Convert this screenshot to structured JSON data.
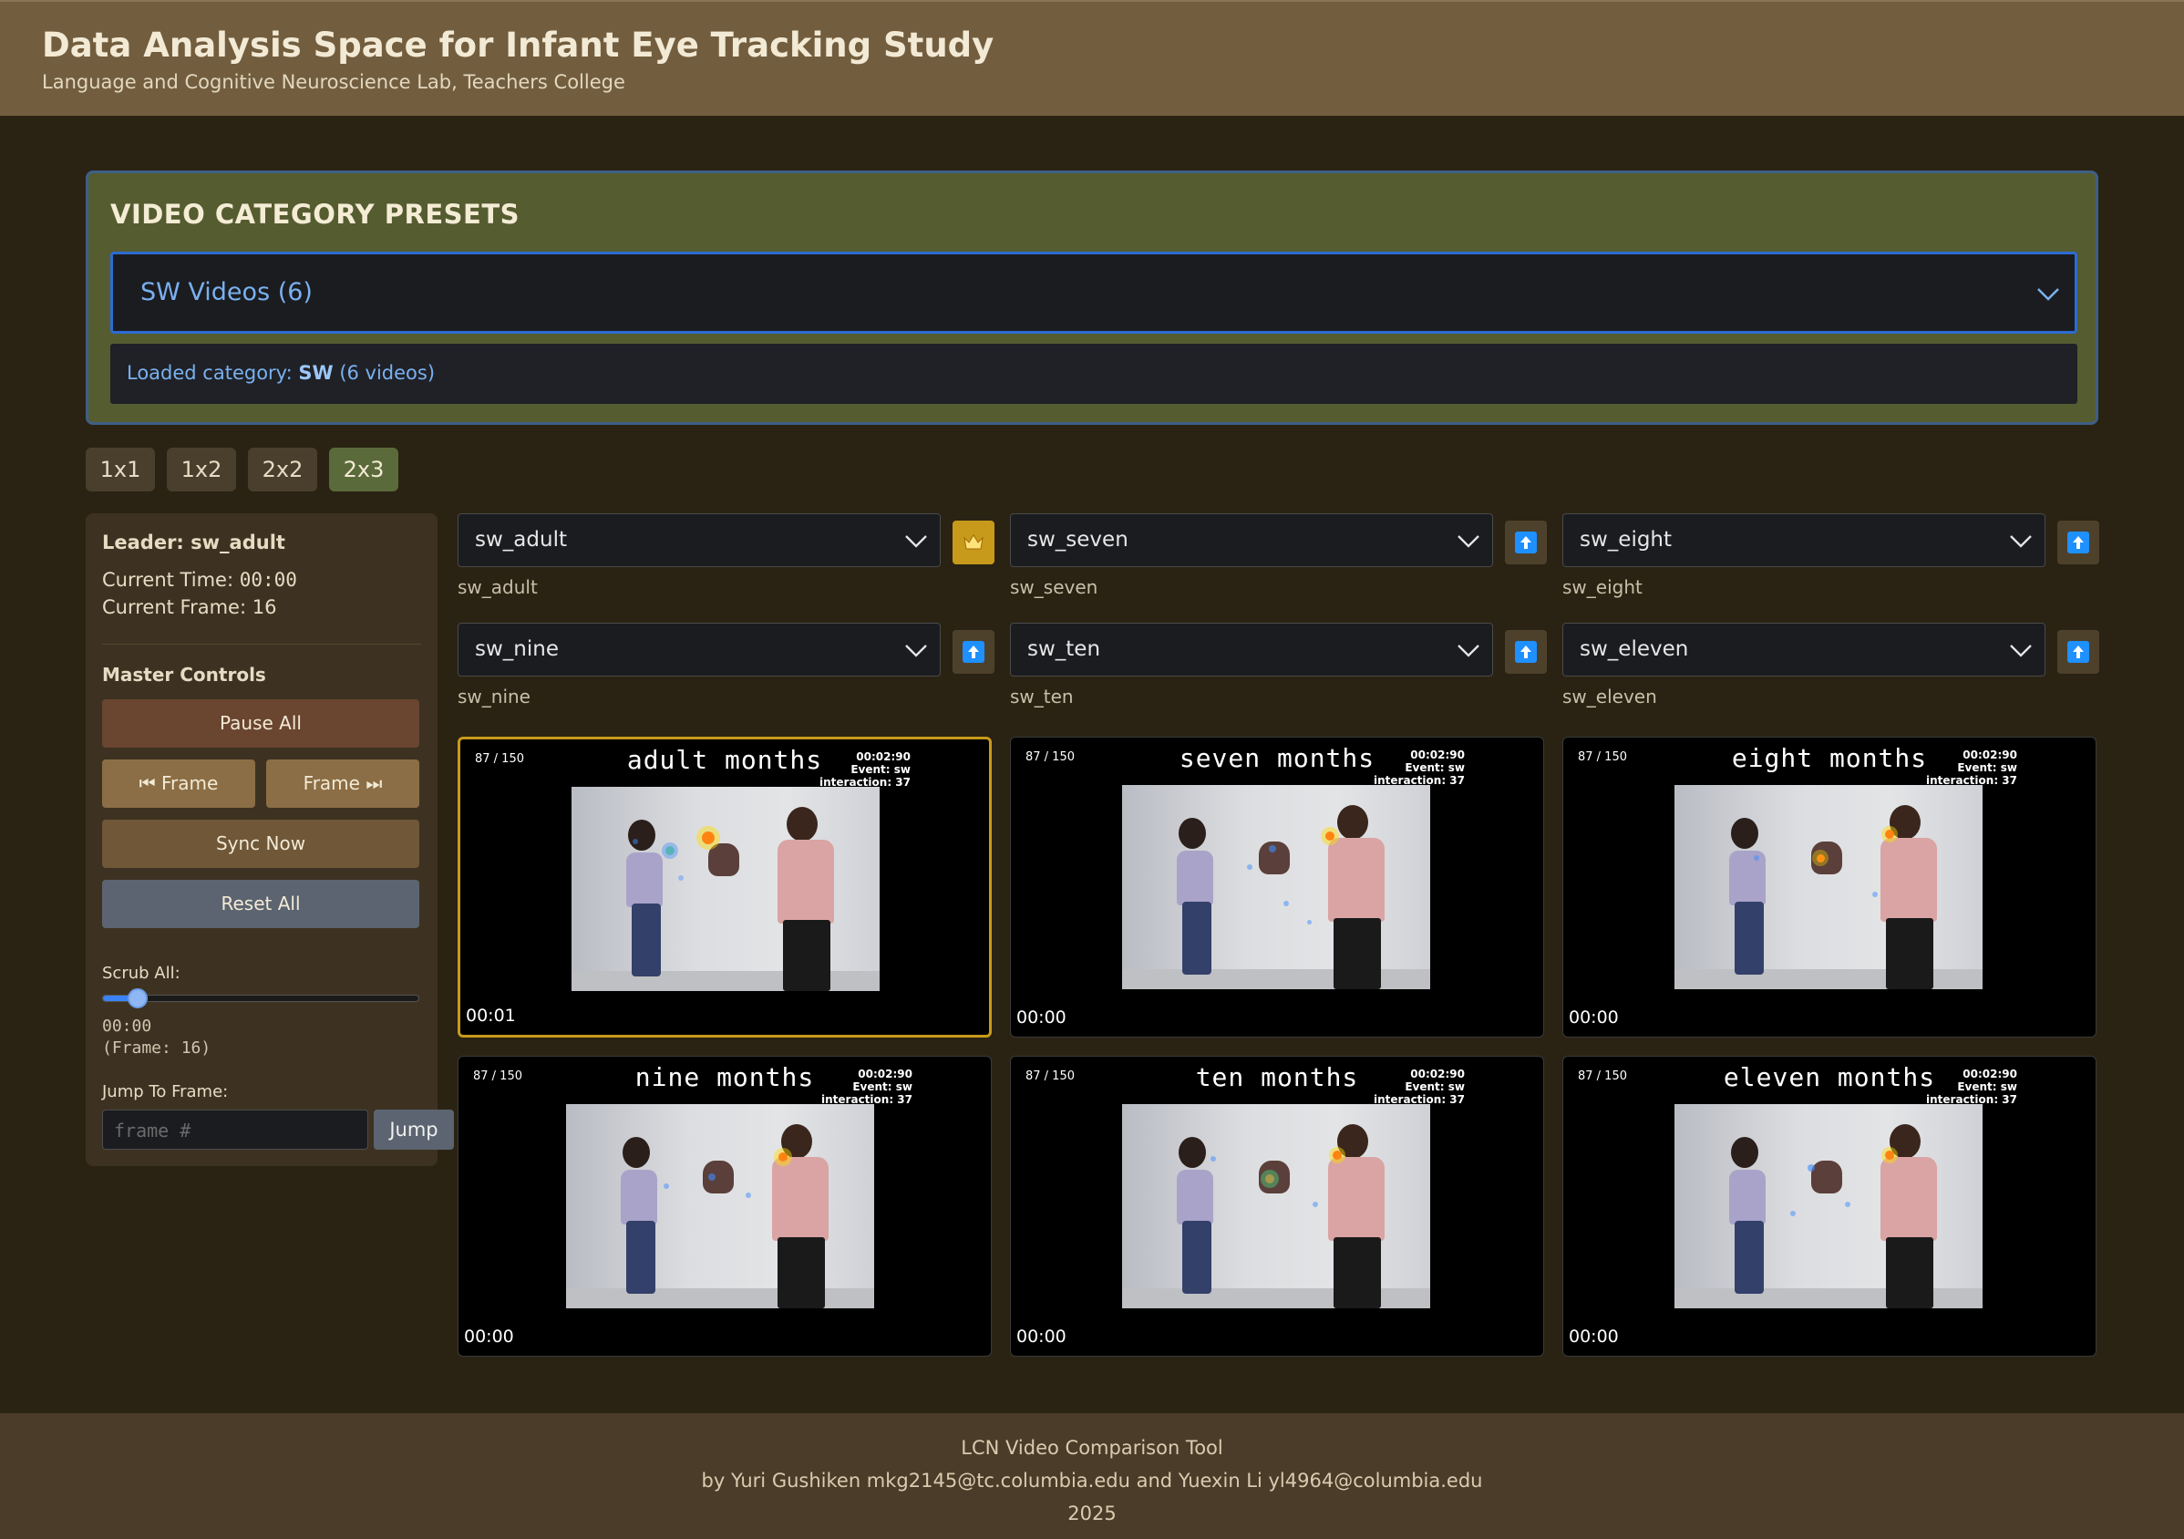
{
  "header": {
    "title": "Data Analysis Space for Infant Eye Tracking Study",
    "subtitle": "Language and Cognitive Neuroscience Lab, Teachers College"
  },
  "presets": {
    "heading": "VIDEO CATEGORY PRESETS",
    "selected": "SW Videos (6)",
    "info_prefix": "Loaded category: ",
    "info_category": "SW",
    "info_suffix": " (6 videos)"
  },
  "layouts": [
    "1x1",
    "1x2",
    "2x2",
    "2x3"
  ],
  "active_layout": "2x3",
  "left_panel": {
    "leader": "Leader: sw_adult",
    "current_time_label": "Current Time: ",
    "current_time": "00:00",
    "current_frame": "Current Frame: 16",
    "master_controls": "Master Controls",
    "pause_all": "Pause All",
    "prev_frame": "⏮ Frame",
    "next_frame": "Frame ⏭",
    "sync_now": "Sync Now",
    "reset_all": "Reset All",
    "scrub_label": "Scrub All:",
    "scrub_time": "00:00",
    "scrub_frame": "(Frame: 16)",
    "scrub_fraction": 0.11,
    "jump_label": "Jump To Frame:",
    "jump_placeholder": "frame #",
    "jump_button": "Jump"
  },
  "videos": [
    {
      "select": "sw_adult",
      "label": "sw_adult",
      "overlay": "adult months",
      "frame": "87 / 150",
      "meta1": "00:02:90",
      "meta2": "Event: sw",
      "meta3": "interaction: 37",
      "time": "00:01",
      "leader": true,
      "button_icon": "crown-icon"
    },
    {
      "select": "sw_seven",
      "label": "sw_seven",
      "overlay": "seven months",
      "frame": "87 / 150",
      "meta1": "00:02:90",
      "meta2": "Event: sw",
      "meta3": "interaction: 37",
      "time": "00:00",
      "leader": false,
      "button_icon": "make-leader-icon"
    },
    {
      "select": "sw_eight",
      "label": "sw_eight",
      "overlay": "eight months",
      "frame": "87 / 150",
      "meta1": "00:02:90",
      "meta2": "Event: sw",
      "meta3": "interaction: 37",
      "time": "00:00",
      "leader": false,
      "button_icon": "make-leader-icon"
    },
    {
      "select": "sw_nine",
      "label": "sw_nine",
      "overlay": "nine months",
      "frame": "87 / 150",
      "meta1": "00:02:90",
      "meta2": "Event: sw",
      "meta3": "interaction: 37",
      "time": "00:00",
      "leader": false,
      "button_icon": "make-leader-icon"
    },
    {
      "select": "sw_ten",
      "label": "sw_ten",
      "overlay": "ten months",
      "frame": "87 / 150",
      "meta1": "00:02:90",
      "meta2": "Event: sw",
      "meta3": "interaction: 37",
      "time": "00:00",
      "leader": false,
      "button_icon": "make-leader-icon"
    },
    {
      "select": "sw_eleven",
      "label": "sw_eleven",
      "overlay": "eleven months",
      "frame": "87 / 150",
      "meta1": "00:02:90",
      "meta2": "Event: sw",
      "meta3": "interaction: 37",
      "time": "00:00",
      "leader": false,
      "button_icon": "make-leader-icon"
    }
  ],
  "footer": {
    "line1": "LCN Video Comparison Tool",
    "line2": "by Yuri Gushiken mkg2145@tc.columbia.edu and Yuexin Li yl4964@columbia.edu",
    "line3": "2025"
  },
  "colors": {
    "header_bg": "#725e3f",
    "page_bg": "#2a2313",
    "preset_bg": "#555c30",
    "leader_gold": "#c89a1b",
    "accent_blue": "#7ab1ef"
  }
}
